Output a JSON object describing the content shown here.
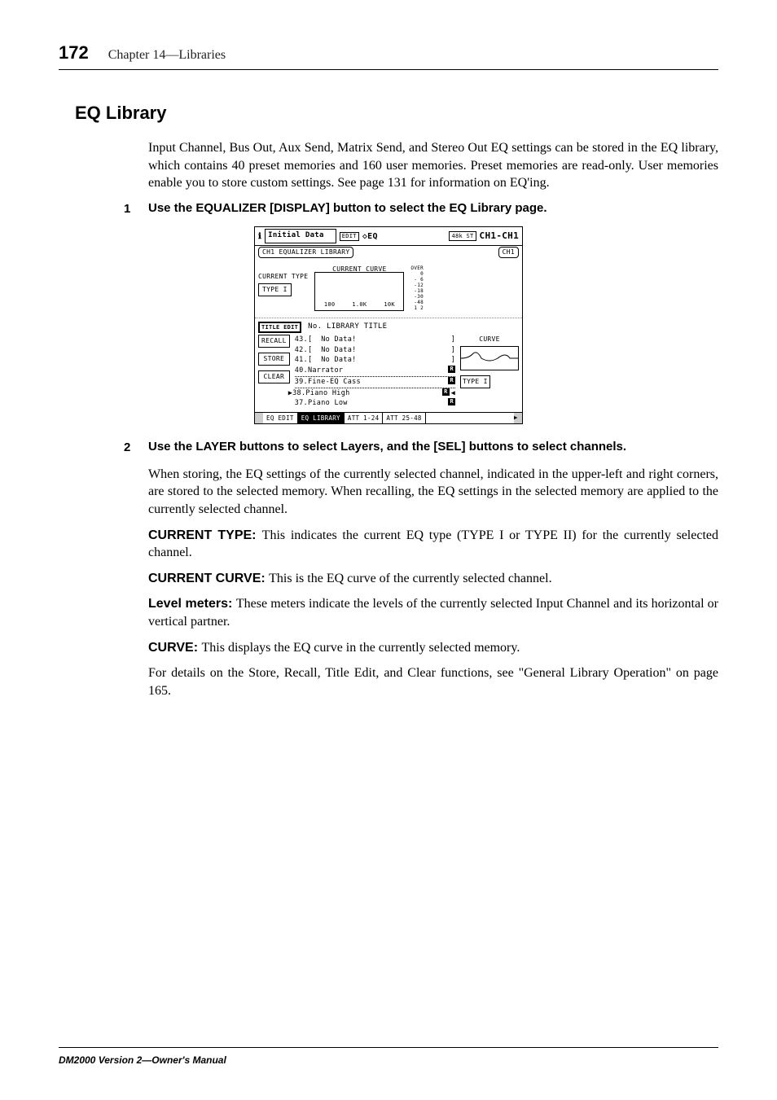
{
  "header": {
    "page_number": "172",
    "chapter": "Chapter 14—Libraries"
  },
  "section": {
    "title": "EQ Library"
  },
  "intro": "Input Channel, Bus Out, Aux Send, Matrix Send, and Stereo Out EQ settings can be stored in the EQ library, which contains 40 preset memories and 160 user memories. Preset memories are read-only. User memories enable you to store custom settings. See page 131 for information on EQ'ing.",
  "steps": [
    {
      "num": "1",
      "text": "Use the EQUALIZER [DISPLAY] button to select the EQ Library page."
    },
    {
      "num": "2",
      "text": "Use the LAYER buttons to select Layers, and the [SEL] buttons to select channels."
    }
  ],
  "step2_body": "When storing, the EQ settings of the currently selected channel, indicated in the upper-left and right corners, are stored to the selected memory. When recalling, the EQ settings in the selected memory are applied to the currently selected channel.",
  "params": [
    {
      "name": "CURRENT TYPE: ",
      "desc": "This indicates the current EQ type (TYPE I or TYPE II) for the currently selected channel."
    },
    {
      "name": "CURRENT CURVE: ",
      "desc": "This is the EQ curve of the currently selected channel."
    },
    {
      "name": "Level meters: ",
      "desc": "These meters indicate the levels of the currently selected Input Channel and its horizontal or vertical partner."
    },
    {
      "name": "CURVE: ",
      "desc": "This displays the EQ curve in the currently selected memory."
    }
  ],
  "closing": "For details on the Store, Recall, Title Edit, and Clear functions, see \"General Library Operation\" on page 165.",
  "footer": "DM2000 Version 2—Owner's Manual",
  "screenshot": {
    "top": {
      "initial": "Initial Data",
      "edit": "EDIT",
      "eq": "◇EQ",
      "khz": "48k\nST",
      "ch": "CH1-CH1"
    },
    "row2": {
      "left": "CH1 EQUALIZER LIBRARY",
      "right": "CH1"
    },
    "mid": {
      "current_type_label": "CURRENT TYPE",
      "current_type_value": "TYPE I",
      "current_curve_label": "CURRENT CURVE",
      "ticks": [
        "100",
        "1.0K",
        "10K"
      ],
      "meter_labels": [
        "OVER",
        "0",
        "- 6",
        "-12",
        "-18",
        "-30",
        "-48"
      ],
      "meter_cols": "1  2"
    },
    "bottom": {
      "title_edit": "TITLE\nEDIT",
      "header": "No.  LIBRARY TITLE",
      "buttons": [
        "RECALL",
        "STORE",
        "CLEAR"
      ],
      "list": [
        {
          "no": "43.[",
          "title": "  No Data!",
          "bracket": "]",
          "r": false
        },
        {
          "no": "42.[",
          "title": "  No Data!",
          "bracket": "]",
          "r": false
        },
        {
          "no": "41.[",
          "title": "  No Data!",
          "bracket": "]",
          "r": false
        },
        {
          "no": "40.Narrator",
          "title": "",
          "bracket": "",
          "r": true
        },
        {
          "no": "39.Fine-EQ Cass",
          "title": "",
          "bracket": "",
          "r": true,
          "dotted": true
        },
        {
          "no": "38.Piano High",
          "title": "",
          "bracket": "",
          "r": true,
          "dotted": true,
          "selected": true
        },
        {
          "no": "37.Piano Low",
          "title": "",
          "bracket": "",
          "r": true
        }
      ],
      "right_curve": "CURVE",
      "right_type": "TYPE I"
    },
    "tabs": [
      "EQ EDIT",
      "EQ LIBRARY",
      "ATT 1-24",
      "ATT 25-48"
    ]
  }
}
